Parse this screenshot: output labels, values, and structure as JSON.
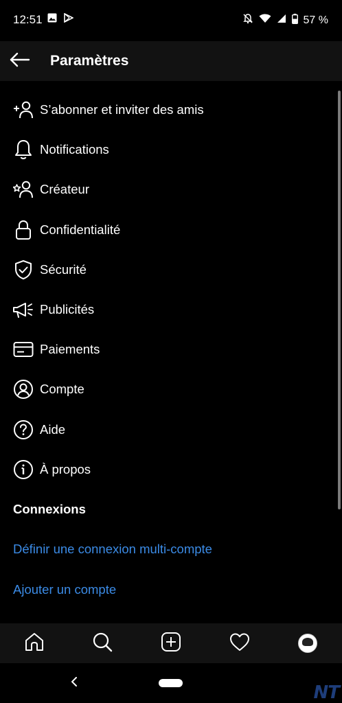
{
  "status_bar": {
    "time": "12:51",
    "left_icons": [
      "image-icon",
      "play-store-icon"
    ],
    "right_icons": [
      "mute-alarm-icon",
      "wifi-icon",
      "signal-icon",
      "battery-icon"
    ],
    "battery": "57 %"
  },
  "header": {
    "back_icon": "arrow-left-icon",
    "title": "Paramètres"
  },
  "settings": {
    "items": [
      {
        "icon": "add-person-icon",
        "label": "S’abonner et inviter des amis"
      },
      {
        "icon": "bell-icon",
        "label": "Notifications"
      },
      {
        "icon": "creator-star-person-icon",
        "label": "Créateur"
      },
      {
        "icon": "lock-icon",
        "label": "Confidentialité"
      },
      {
        "icon": "shield-check-icon",
        "label": "Sécurité"
      },
      {
        "icon": "megaphone-icon",
        "label": "Publicités"
      },
      {
        "icon": "card-icon",
        "label": "Paiements"
      },
      {
        "icon": "account-circle-icon",
        "label": "Compte"
      },
      {
        "icon": "help-circle-icon",
        "label": "Aide"
      },
      {
        "icon": "info-circle-icon",
        "label": "À propos"
      }
    ],
    "section_title": "Connexions",
    "links": {
      "multi_account": "Définir une connexion multi-compte",
      "add_account": "Ajouter un compte"
    },
    "link_color": "#3b8be6"
  },
  "bottom_nav": {
    "items": [
      "home-icon",
      "search-icon",
      "add-post-icon",
      "heart-icon",
      "profile-avatar"
    ]
  },
  "system_nav": {
    "items": [
      "back-chevron-icon",
      "home-pill"
    ]
  },
  "watermark": "NT"
}
